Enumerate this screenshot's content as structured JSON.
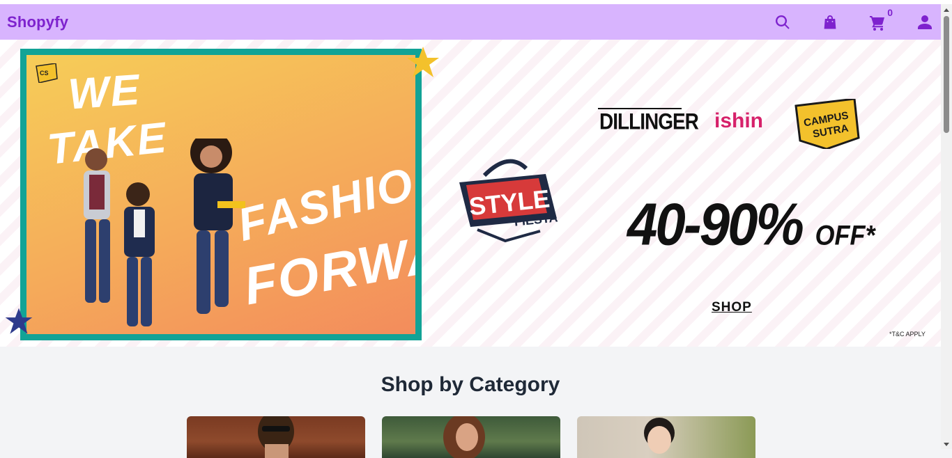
{
  "app": {
    "brand": "Shopyfy"
  },
  "header": {
    "icons": [
      "search-icon",
      "shopping-bag-icon",
      "cart-icon",
      "user-icon"
    ],
    "cart_count": "0",
    "colors": {
      "bar": "#d8b4fe",
      "accent": "#7e22ce"
    }
  },
  "hero": {
    "headline_lines": [
      "WE",
      "TAKE",
      "FASHION",
      "FORWARD"
    ],
    "brands": [
      "DILLINGER",
      "ishin",
      "CAMPUS SUTRA"
    ],
    "badge": "STYLE FIESTA",
    "offer": "40-90%",
    "offer_suffix": "OFF*",
    "cta": "SHOP",
    "disclaimer": "*T&C APPLY",
    "frame_color": "#12a396"
  },
  "categories": {
    "title": "Shop by Category"
  }
}
